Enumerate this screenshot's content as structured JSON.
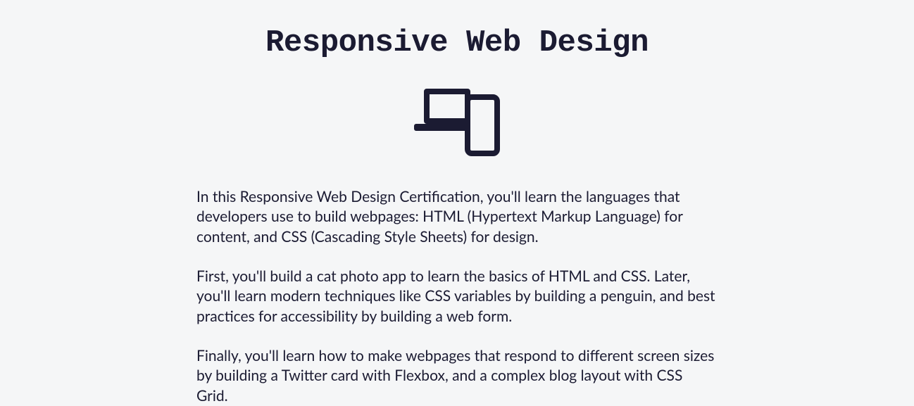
{
  "title": "Responsive Web Design",
  "paragraphs": [
    "In this Responsive Web Design Certification, you'll learn the languages that developers use to build webpages: HTML (Hypertext Markup Language) for content, and CSS (Cascading Style Sheets) for design.",
    "First, you'll build a cat photo app to learn the basics of HTML and CSS. Later, you'll learn modern techniques like CSS variables by building a penguin, and best practices for accessibility by building a web form.",
    "Finally, you'll learn how to make webpages that respond to different screen sizes by building a Twitter card with Flexbox, and a complex blog layout with CSS Grid."
  ],
  "icon_name": "responsive-web-design-icon",
  "colors": {
    "background": "#f5f6f7",
    "text": "#1b1b32"
  }
}
